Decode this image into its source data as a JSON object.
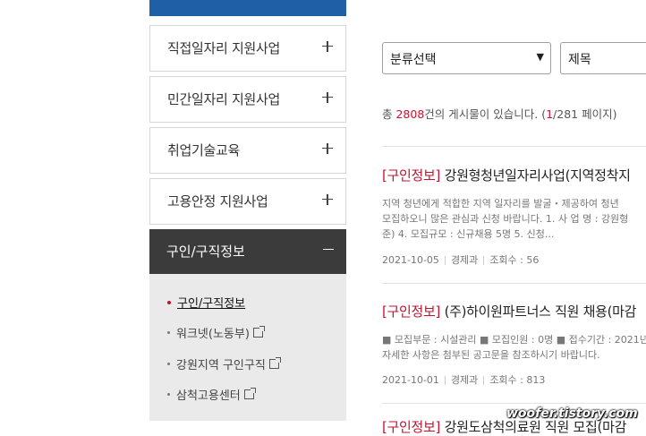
{
  "sidebar": {
    "items": [
      {
        "label": "직접일자리 지원사업"
      },
      {
        "label": "민간일자리 지원사업"
      },
      {
        "label": "취업기술교육"
      },
      {
        "label": "고용안정 지원사업"
      }
    ],
    "active": {
      "label": "구인/구직정보"
    },
    "submenu": [
      {
        "label": "구인/구직정보"
      },
      {
        "label": "워크넷(노동부)"
      },
      {
        "label": "강원지역 구인구직"
      },
      {
        "label": "삼척고용센터"
      }
    ]
  },
  "filters": {
    "category_value": "분류선택",
    "field_value": "제목"
  },
  "summary": {
    "prefix": "총 ",
    "total": "2808",
    "mid": "건의 게시물이 있습니다. (",
    "page": "1",
    "suffix": "/281 페이지)"
  },
  "posts": [
    {
      "category": "[구인정보]",
      "title": " 강원형청년일자리사업(지역정착지",
      "body": [
        "지역 청년에게 적합한 지역 일자리를 발굴・제공하여 청년",
        "모집하오니 많은 관심과 신청 바랍니다. 1. 사 업 명 : 강원형",
        "준) 4. 모집규모 : 신규채용 5명 5. 신청..."
      ],
      "date": "2021-10-05",
      "dept": "경제과",
      "views": "조회수 : 56"
    },
    {
      "category": "[구인정보]",
      "title": " (주)하이원파트너스 직원 채용(마감",
      "body": [
        "■ 모집부문 : 시설관리 ■ 모집인원 : 0명 ■ 접수기간 : 2021년",
        "자세한 사항은 첨부된 공고문을 참조하시기 바랍니다."
      ],
      "date": "2021-10-01",
      "dept": "경제과",
      "views": "조회수 : 813"
    },
    {
      "category": "[구인정보]",
      "title": " 강원도삼척의료원 직원 모집(마감"
    }
  ],
  "watermark": "woofer.tistory.com"
}
